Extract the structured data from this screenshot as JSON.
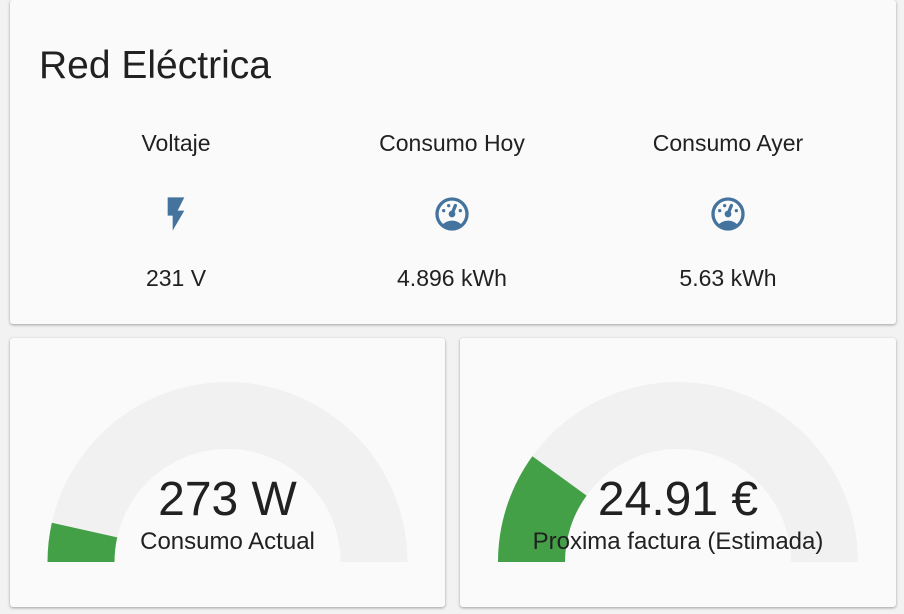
{
  "glance_card": {
    "title": "Red Eléctrica",
    "entities": [
      {
        "name": "Voltaje",
        "state": "231 V",
        "icon": "flash-icon"
      },
      {
        "name": "Consumo Hoy",
        "state": "4.896 kWh",
        "icon": "gauge-icon"
      },
      {
        "name": "Consumo Ayer",
        "state": "5.63 kWh",
        "icon": "gauge-icon"
      }
    ]
  },
  "gauges": [
    {
      "value": "273 W",
      "label": "Consumo Actual",
      "fraction": 0.07
    },
    {
      "value": "24.91 €",
      "label": "Proxima factura (Estimada)",
      "fraction": 0.2
    }
  ],
  "colors": {
    "icon": "#44739e",
    "gauge_fill": "#43a047",
    "gauge_track": "#f1f1f1",
    "card_bg": "#fafafa",
    "page_bg": "#f2f2f2"
  }
}
